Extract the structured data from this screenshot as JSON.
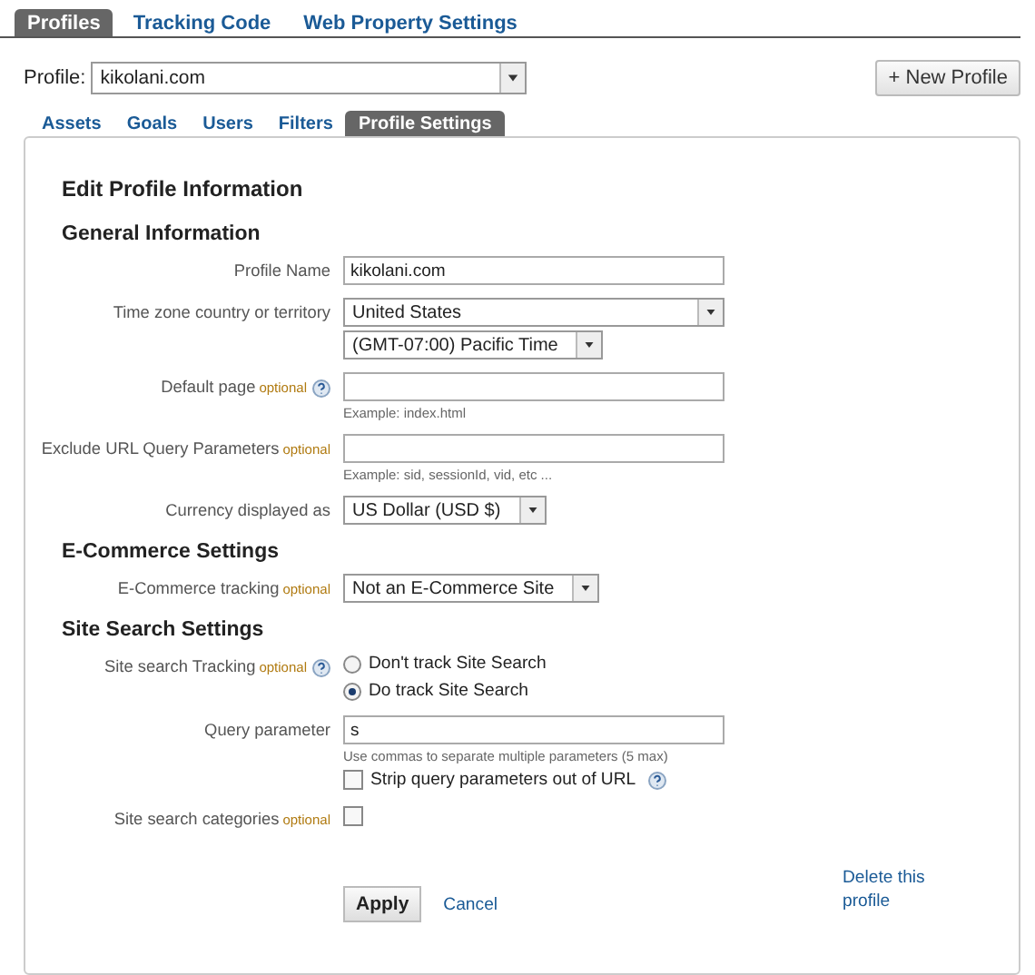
{
  "top_tabs": [
    {
      "label": "Profiles",
      "selected": true
    },
    {
      "label": "Tracking Code",
      "selected": false
    },
    {
      "label": "Web Property Settings",
      "selected": false
    }
  ],
  "profile_picker": {
    "label": "Profile:",
    "value": "kikolani.com"
  },
  "new_profile_button": "+ New Profile",
  "sub_tabs": [
    {
      "label": "Assets",
      "selected": false
    },
    {
      "label": "Goals",
      "selected": false
    },
    {
      "label": "Users",
      "selected": false
    },
    {
      "label": "Filters",
      "selected": false
    },
    {
      "label": "Profile Settings",
      "selected": true
    }
  ],
  "panel": {
    "title": "Edit Profile Information",
    "sections": [
      {
        "heading": "General Information",
        "fields": [
          {
            "kind": "text",
            "label": "Profile Name",
            "value": "kikolani.com"
          },
          {
            "kind": "selects",
            "label": "Time zone country or territory",
            "selects": [
              "United States",
              "(GMT-07:00) Pacific Time"
            ]
          },
          {
            "kind": "text",
            "label": "Default page",
            "optional": "optional",
            "help": true,
            "hint": "Example: index.html"
          },
          {
            "kind": "text",
            "label": "Exclude URL Query Parameters",
            "optional": "optional",
            "hint": "Example: sid, sessionId, vid, etc ..."
          },
          {
            "kind": "selects",
            "label": "Currency displayed as",
            "selects": [
              "US Dollar (USD $)"
            ]
          }
        ]
      },
      {
        "heading": "E-Commerce Settings",
        "fields": [
          {
            "kind": "selects",
            "label": "E-Commerce tracking",
            "optional": "optional",
            "selects": [
              "Not an E-Commerce Site"
            ]
          }
        ]
      },
      {
        "heading": "Site Search Settings",
        "fields": [
          {
            "kind": "radios",
            "label": "Site search Tracking",
            "optional": "optional",
            "help": true,
            "options": [
              {
                "label": "Don't track Site Search",
                "selected": false
              },
              {
                "label": "Do track Site Search",
                "selected": true
              }
            ]
          },
          {
            "kind": "text",
            "label": "Query parameter",
            "value": "s",
            "hint": "Use commas to separate multiple parameters (5 max)",
            "checkbox": {
              "label": "Strip query parameters out of URL",
              "checked": false,
              "help": true
            }
          },
          {
            "kind": "checkbox",
            "label": "Site search categories",
            "optional": "optional",
            "checked": false
          }
        ]
      }
    ]
  },
  "apply_button": "Apply",
  "cancel_link": "Cancel",
  "delete_link": "Delete this profile"
}
